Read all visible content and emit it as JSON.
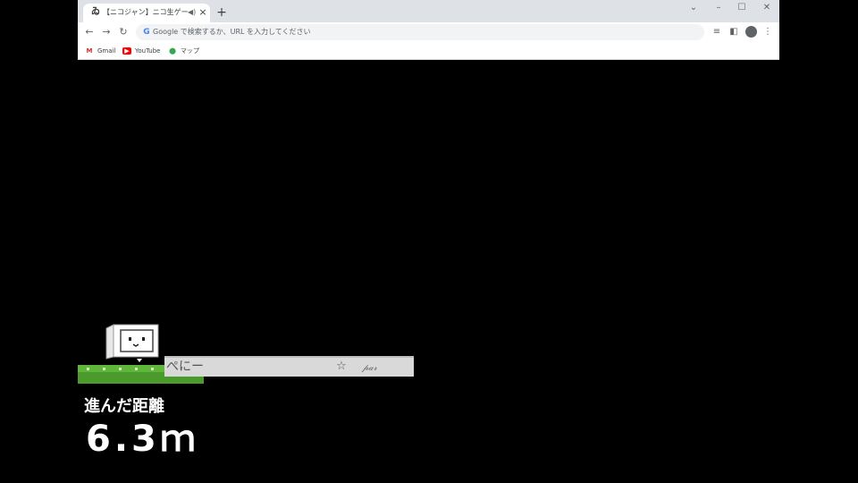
{
  "browser": {
    "tab": {
      "favicon": "niconico-logo",
      "title": "【ニコジャン】ニコ生ゲーム練習(ゆ",
      "audio_icon": "speaker-icon",
      "close_label": "×"
    },
    "new_tab_label": "+",
    "window_controls": {
      "tab_search": "⌄",
      "minimize": "–",
      "maximize": "☐",
      "close": "✕"
    },
    "toolbar": {
      "back": "←",
      "forward": "→",
      "reload": "↻",
      "omnibox_placeholder": "Google で検索するか、URL を入力してください",
      "reading_list": "≡",
      "side_panel": "◧",
      "menu": "⋮"
    },
    "bookmarks": [
      {
        "label": "Gmail",
        "icon": "gmail-icon",
        "color": "#d93025"
      },
      {
        "label": "YouTube",
        "icon": "youtube-icon",
        "color": "#ff0000"
      },
      {
        "label": "マップ",
        "icon": "maps-icon",
        "color": "#34a853"
      }
    ]
  },
  "game": {
    "comment": {
      "name": "ぺにー",
      "star": "☆",
      "signature": "𝓅𝒶𝓇"
    },
    "distance_label": "進んだ距離",
    "distance_value": "6.3ｍ",
    "colors": {
      "ground": "#4a9a2c",
      "ground_top": "#5fb63a",
      "background": "#000000"
    }
  }
}
